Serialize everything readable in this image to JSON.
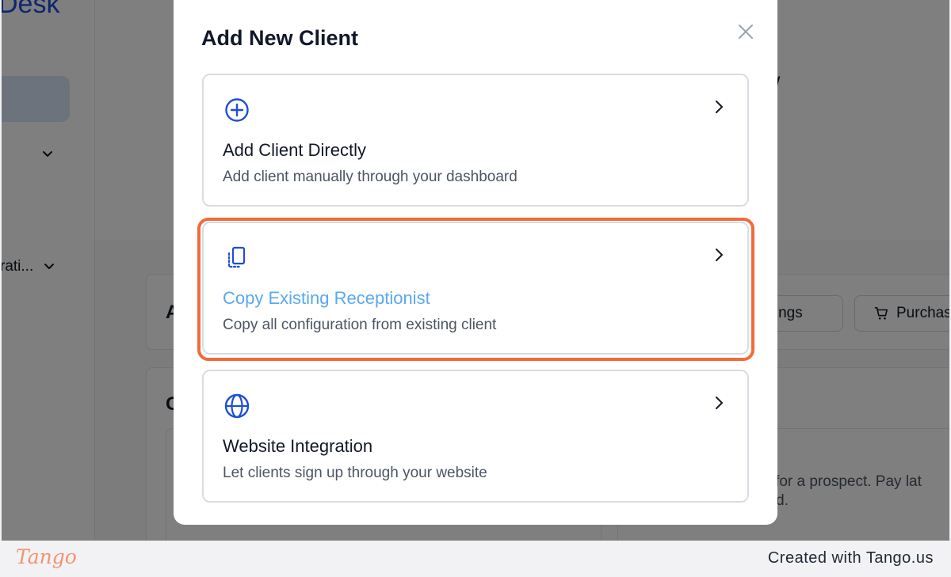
{
  "background": {
    "brand_fragment": "Desk",
    "sidebar_label_fragment": "rati...",
    "panel_letters": [
      "A",
      "G"
    ],
    "buttons": [
      {
        "label": "rnings",
        "icon": "none"
      },
      {
        "label": "Purchas",
        "icon": "cart-icon"
      }
    ],
    "body_text": [
      "al for a prospect. Pay lat",
      "ned."
    ]
  },
  "modal": {
    "title": "Add New Client",
    "close_icon": "close-icon",
    "options": [
      {
        "icon": "plus-circle-icon",
        "title": "Add Client Directly",
        "description": "Add client manually through your dashboard"
      },
      {
        "icon": "copy-icon",
        "title": "Copy Existing Receptionist",
        "description": "Copy all configuration from existing client"
      },
      {
        "icon": "globe-icon",
        "title": "Website Integration",
        "description": "Let clients sign up through your website"
      }
    ]
  },
  "highlight": {
    "option_index": 1,
    "color": "#f26b3a"
  },
  "colors": {
    "accent": "#1d4ed8",
    "highlight_title": "#5aa8f0",
    "tango": "#f29470"
  },
  "footer": {
    "logo": "Tango",
    "credit": "Created with Tango.us"
  }
}
